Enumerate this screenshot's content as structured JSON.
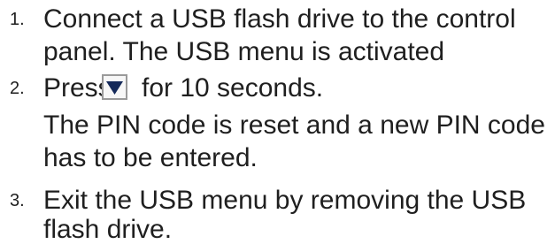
{
  "steps": [
    {
      "number": "1.",
      "lines": [
        "Connect a USB flash drive to the control",
        "panel. The USB menu is activated"
      ]
    },
    {
      "number": "2.",
      "action_press": "Press",
      "action_key_icon": "down-arrow-key-icon",
      "action_duration": "for 10 seconds.",
      "result_lines": [
        "The PIN code is reset and a new PIN code",
        "has to be entered."
      ]
    },
    {
      "number": "3.",
      "lines": [
        "Exit the USB menu by removing the USB",
        "flash drive."
      ]
    }
  ],
  "colors": {
    "text": "#1f1f1f",
    "key_border": "#9a9a9a",
    "key_background": "#f7f7f7",
    "key_arrow": "#152a5a"
  }
}
